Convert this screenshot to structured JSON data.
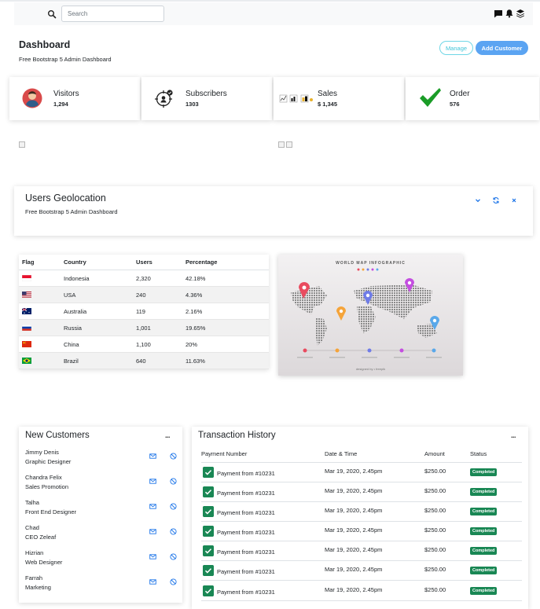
{
  "search": {
    "placeholder": "Search"
  },
  "header": {
    "title": "Dashboard",
    "subtitle": "Free Bootstrap 5 Admin Dashboard",
    "manage_label": "Manage",
    "add_customer_label": "Add Customer"
  },
  "stats": [
    {
      "label": "Visitors",
      "value": "1,294"
    },
    {
      "label": "Subscribers",
      "value": "1303"
    },
    {
      "label": "Sales",
      "value": "$ 1,345"
    },
    {
      "label": "Order",
      "value": "576"
    }
  ],
  "geolocation": {
    "title": "Users Geolocation",
    "subtitle": "Free Bootstrap 5 Admin Dashboard",
    "columns": [
      "Flag",
      "Country",
      "Users",
      "Percentage"
    ],
    "rows": [
      {
        "flag": "indonesia-flag-icon",
        "country": "Indonesia",
        "users": "2,320",
        "percentage": "42.18%"
      },
      {
        "flag": "usa-flag-icon",
        "country": "USA",
        "users": "240",
        "percentage": "4.36%"
      },
      {
        "flag": "australia-flag-icon",
        "country": "Australia",
        "users": "119",
        "percentage": "2.16%"
      },
      {
        "flag": "russia-flag-icon",
        "country": "Russia",
        "users": "1,001",
        "percentage": "19.65%"
      },
      {
        "flag": "china-flag-icon",
        "country": "China",
        "users": "1,100",
        "percentage": "20%"
      },
      {
        "flag": "brazil-flag-icon",
        "country": "Brazil",
        "users": "640",
        "percentage": "11.63%"
      }
    ]
  },
  "map_image": {
    "title": "WORLD MAP INFOGRAPHIC",
    "credit": "designed by • freepik"
  },
  "new_customers": {
    "title": "New Customers",
    "menu_label": "...",
    "items": [
      {
        "name": "Jimmy Denis",
        "role": "Graphic Designer"
      },
      {
        "name": "Chandra Felix",
        "role": "Sales Promotion"
      },
      {
        "name": "Talha",
        "role": "Front End Designer"
      },
      {
        "name": "Chad",
        "role": "CEO Zeleaf"
      },
      {
        "name": "Hizrian",
        "role": "Web Designer"
      },
      {
        "name": "Farrah",
        "role": "Marketing"
      }
    ]
  },
  "transactions": {
    "title": "Transaction History",
    "menu_label": "...",
    "columns": [
      "Payment Number",
      "Date & Time",
      "Amount",
      "Status"
    ],
    "rows": [
      {
        "payment": "Payment from #10231",
        "date": "Mar 19, 2020, 2.45pm",
        "amount": "$250.00",
        "status": "Completed"
      },
      {
        "payment": "Payment from #10231",
        "date": "Mar 19, 2020, 2.45pm",
        "amount": "$250.00",
        "status": "Completed"
      },
      {
        "payment": "Payment from #10231",
        "date": "Mar 19, 2020, 2.45pm",
        "amount": "$250.00",
        "status": "Completed"
      },
      {
        "payment": "Payment from #10231",
        "date": "Mar 19, 2020, 2.45pm",
        "amount": "$250.00",
        "status": "Completed"
      },
      {
        "payment": "Payment from #10231",
        "date": "Mar 19, 2020, 2.45pm",
        "amount": "$250.00",
        "status": "Completed"
      },
      {
        "payment": "Payment from #10231",
        "date": "Mar 19, 2020, 2.45pm",
        "amount": "$250.00",
        "status": "Completed"
      },
      {
        "payment": "Payment from #10231",
        "date": "Mar 19, 2020, 2.45pm",
        "amount": "$250.00",
        "status": "Completed"
      }
    ]
  },
  "colors": {
    "accent": "#5ba4f2",
    "info": "#41c4d8",
    "success": "#198754",
    "check_green": "#1a9c27"
  }
}
